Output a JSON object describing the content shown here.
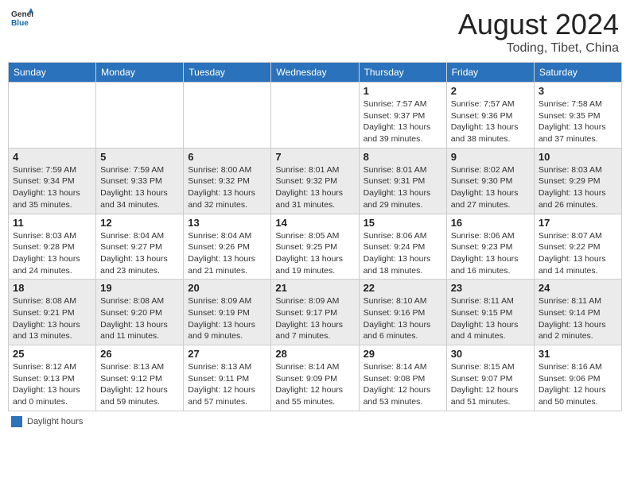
{
  "header": {
    "logo_general": "General",
    "logo_blue": "Blue",
    "month_year": "August 2024",
    "location": "Toding, Tibet, China"
  },
  "weekdays": [
    "Sunday",
    "Monday",
    "Tuesday",
    "Wednesday",
    "Thursday",
    "Friday",
    "Saturday"
  ],
  "weeks": [
    [
      {
        "day": "",
        "info": ""
      },
      {
        "day": "",
        "info": ""
      },
      {
        "day": "",
        "info": ""
      },
      {
        "day": "",
        "info": ""
      },
      {
        "day": "1",
        "info": "Sunrise: 7:57 AM\nSunset: 9:37 PM\nDaylight: 13 hours and 39 minutes."
      },
      {
        "day": "2",
        "info": "Sunrise: 7:57 AM\nSunset: 9:36 PM\nDaylight: 13 hours and 38 minutes."
      },
      {
        "day": "3",
        "info": "Sunrise: 7:58 AM\nSunset: 9:35 PM\nDaylight: 13 hours and 37 minutes."
      }
    ],
    [
      {
        "day": "4",
        "info": "Sunrise: 7:59 AM\nSunset: 9:34 PM\nDaylight: 13 hours and 35 minutes."
      },
      {
        "day": "5",
        "info": "Sunrise: 7:59 AM\nSunset: 9:33 PM\nDaylight: 13 hours and 34 minutes."
      },
      {
        "day": "6",
        "info": "Sunrise: 8:00 AM\nSunset: 9:32 PM\nDaylight: 13 hours and 32 minutes."
      },
      {
        "day": "7",
        "info": "Sunrise: 8:01 AM\nSunset: 9:32 PM\nDaylight: 13 hours and 31 minutes."
      },
      {
        "day": "8",
        "info": "Sunrise: 8:01 AM\nSunset: 9:31 PM\nDaylight: 13 hours and 29 minutes."
      },
      {
        "day": "9",
        "info": "Sunrise: 8:02 AM\nSunset: 9:30 PM\nDaylight: 13 hours and 27 minutes."
      },
      {
        "day": "10",
        "info": "Sunrise: 8:03 AM\nSunset: 9:29 PM\nDaylight: 13 hours and 26 minutes."
      }
    ],
    [
      {
        "day": "11",
        "info": "Sunrise: 8:03 AM\nSunset: 9:28 PM\nDaylight: 13 hours and 24 minutes."
      },
      {
        "day": "12",
        "info": "Sunrise: 8:04 AM\nSunset: 9:27 PM\nDaylight: 13 hours and 23 minutes."
      },
      {
        "day": "13",
        "info": "Sunrise: 8:04 AM\nSunset: 9:26 PM\nDaylight: 13 hours and 21 minutes."
      },
      {
        "day": "14",
        "info": "Sunrise: 8:05 AM\nSunset: 9:25 PM\nDaylight: 13 hours and 19 minutes."
      },
      {
        "day": "15",
        "info": "Sunrise: 8:06 AM\nSunset: 9:24 PM\nDaylight: 13 hours and 18 minutes."
      },
      {
        "day": "16",
        "info": "Sunrise: 8:06 AM\nSunset: 9:23 PM\nDaylight: 13 hours and 16 minutes."
      },
      {
        "day": "17",
        "info": "Sunrise: 8:07 AM\nSunset: 9:22 PM\nDaylight: 13 hours and 14 minutes."
      }
    ],
    [
      {
        "day": "18",
        "info": "Sunrise: 8:08 AM\nSunset: 9:21 PM\nDaylight: 13 hours and 13 minutes."
      },
      {
        "day": "19",
        "info": "Sunrise: 8:08 AM\nSunset: 9:20 PM\nDaylight: 13 hours and 11 minutes."
      },
      {
        "day": "20",
        "info": "Sunrise: 8:09 AM\nSunset: 9:19 PM\nDaylight: 13 hours and 9 minutes."
      },
      {
        "day": "21",
        "info": "Sunrise: 8:09 AM\nSunset: 9:17 PM\nDaylight: 13 hours and 7 minutes."
      },
      {
        "day": "22",
        "info": "Sunrise: 8:10 AM\nSunset: 9:16 PM\nDaylight: 13 hours and 6 minutes."
      },
      {
        "day": "23",
        "info": "Sunrise: 8:11 AM\nSunset: 9:15 PM\nDaylight: 13 hours and 4 minutes."
      },
      {
        "day": "24",
        "info": "Sunrise: 8:11 AM\nSunset: 9:14 PM\nDaylight: 13 hours and 2 minutes."
      }
    ],
    [
      {
        "day": "25",
        "info": "Sunrise: 8:12 AM\nSunset: 9:13 PM\nDaylight: 13 hours and 0 minutes."
      },
      {
        "day": "26",
        "info": "Sunrise: 8:13 AM\nSunset: 9:12 PM\nDaylight: 12 hours and 59 minutes."
      },
      {
        "day": "27",
        "info": "Sunrise: 8:13 AM\nSunset: 9:11 PM\nDaylight: 12 hours and 57 minutes."
      },
      {
        "day": "28",
        "info": "Sunrise: 8:14 AM\nSunset: 9:09 PM\nDaylight: 12 hours and 55 minutes."
      },
      {
        "day": "29",
        "info": "Sunrise: 8:14 AM\nSunset: 9:08 PM\nDaylight: 12 hours and 53 minutes."
      },
      {
        "day": "30",
        "info": "Sunrise: 8:15 AM\nSunset: 9:07 PM\nDaylight: 12 hours and 51 minutes."
      },
      {
        "day": "31",
        "info": "Sunrise: 8:16 AM\nSunset: 9:06 PM\nDaylight: 12 hours and 50 minutes."
      }
    ]
  ],
  "legend": {
    "box_color": "#2a72bb",
    "label": "Daylight hours"
  }
}
